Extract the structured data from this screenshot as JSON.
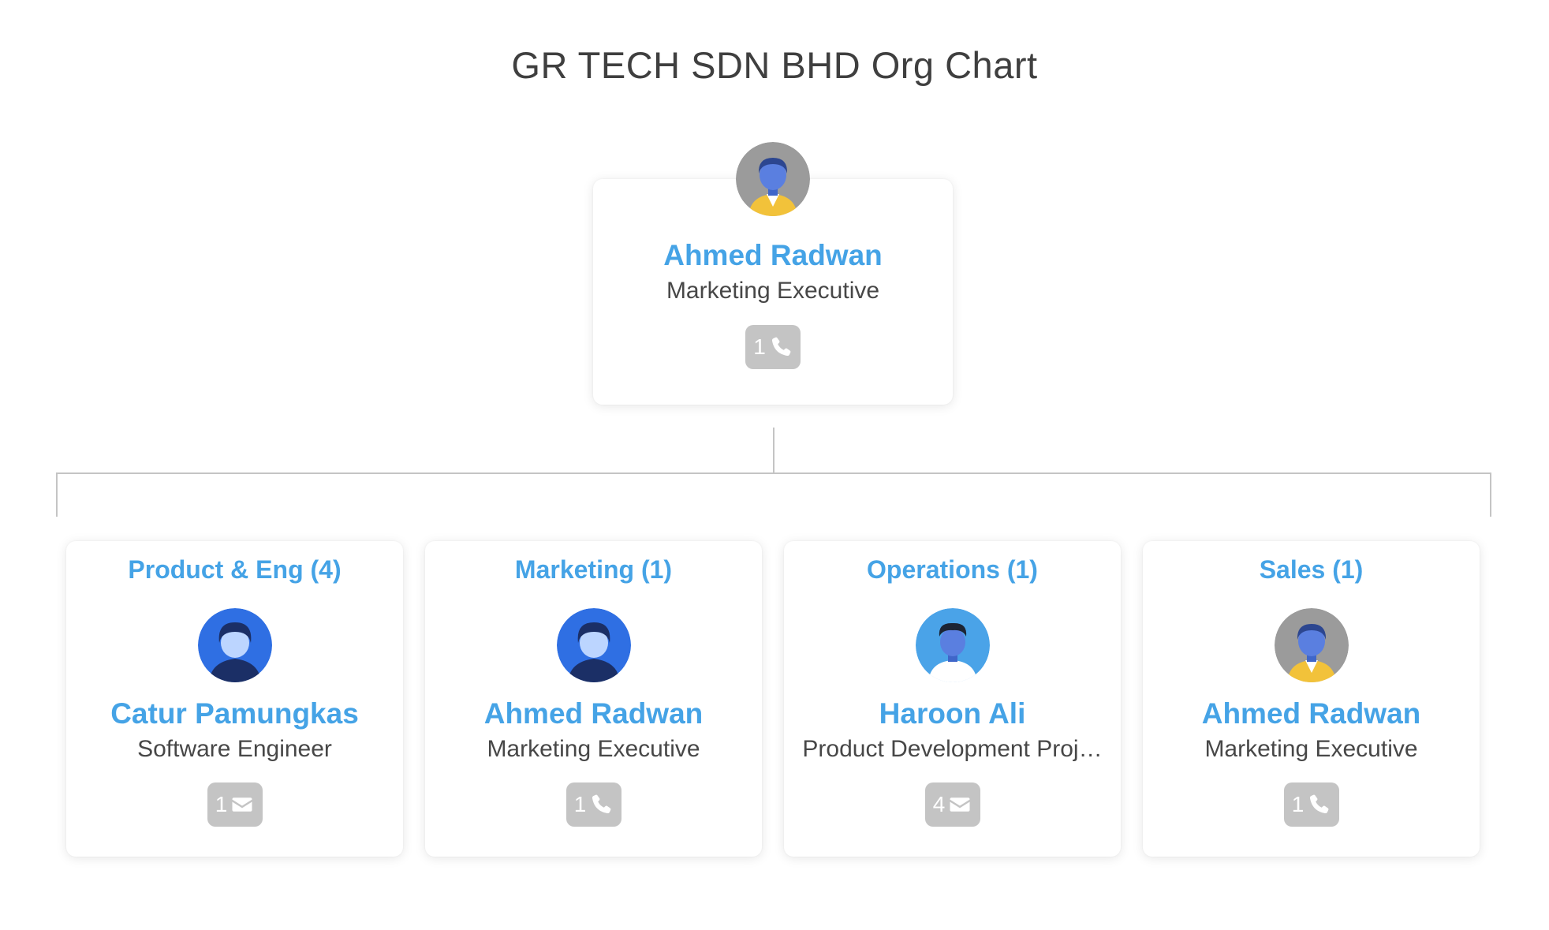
{
  "title": "GR TECH SDN BHD Org Chart",
  "root": {
    "name": "Ahmed Radwan",
    "role": "Marketing Executive",
    "badge_count": "1",
    "badge_icon": "phone-icon",
    "avatar": "avatar-male-yellow-jacket"
  },
  "children": [
    {
      "department": "Product & Eng (4)",
      "name": "Catur Pamungkas",
      "role": "Software Engineer",
      "badge_count": "1",
      "badge_icon": "envelope-icon",
      "avatar": "avatar-blue-hoodie"
    },
    {
      "department": "Marketing (1)",
      "name": "Ahmed Radwan",
      "role": "Marketing Executive",
      "badge_count": "1",
      "badge_icon": "phone-icon",
      "avatar": "avatar-blue-hoodie"
    },
    {
      "department": "Operations (1)",
      "name": "Haroon Ali",
      "role": "Product Development Proj…",
      "badge_count": "4",
      "badge_icon": "envelope-icon",
      "avatar": "avatar-male-white-shirt"
    },
    {
      "department": "Sales (1)",
      "name": "Ahmed Radwan",
      "role": "Marketing Executive",
      "badge_count": "1",
      "badge_icon": "phone-icon",
      "avatar": "avatar-male-yellow-jacket"
    }
  ],
  "colors": {
    "accent": "#45a3e6",
    "badge": "#c4c4c4",
    "connector": "#c4c4c4",
    "text": "#474747"
  }
}
